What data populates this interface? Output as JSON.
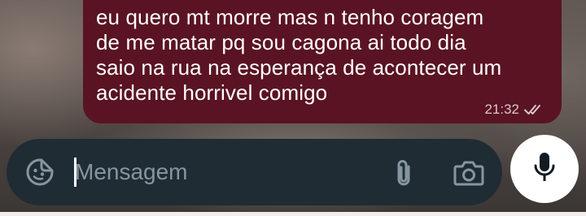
{
  "message": {
    "text": "eu quero mt morre mas n tenho coragem\nde me matar pq sou cagona ai todo dia\nsaio na rua na esperança de acontecer um\nacidente horrivel comigo",
    "time": "21:32",
    "status_icon": "double-check-icon",
    "bubble_color": "#5a1322"
  },
  "composer": {
    "placeholder": "Mensagem",
    "value": "",
    "emoji_icon": "sticker-smiley-icon",
    "attach_icon": "paperclip-icon",
    "camera_icon": "camera-icon",
    "background_color": "#1f2c33"
  },
  "mic_button": {
    "icon": "microphone-icon",
    "color": "#ffffff"
  }
}
